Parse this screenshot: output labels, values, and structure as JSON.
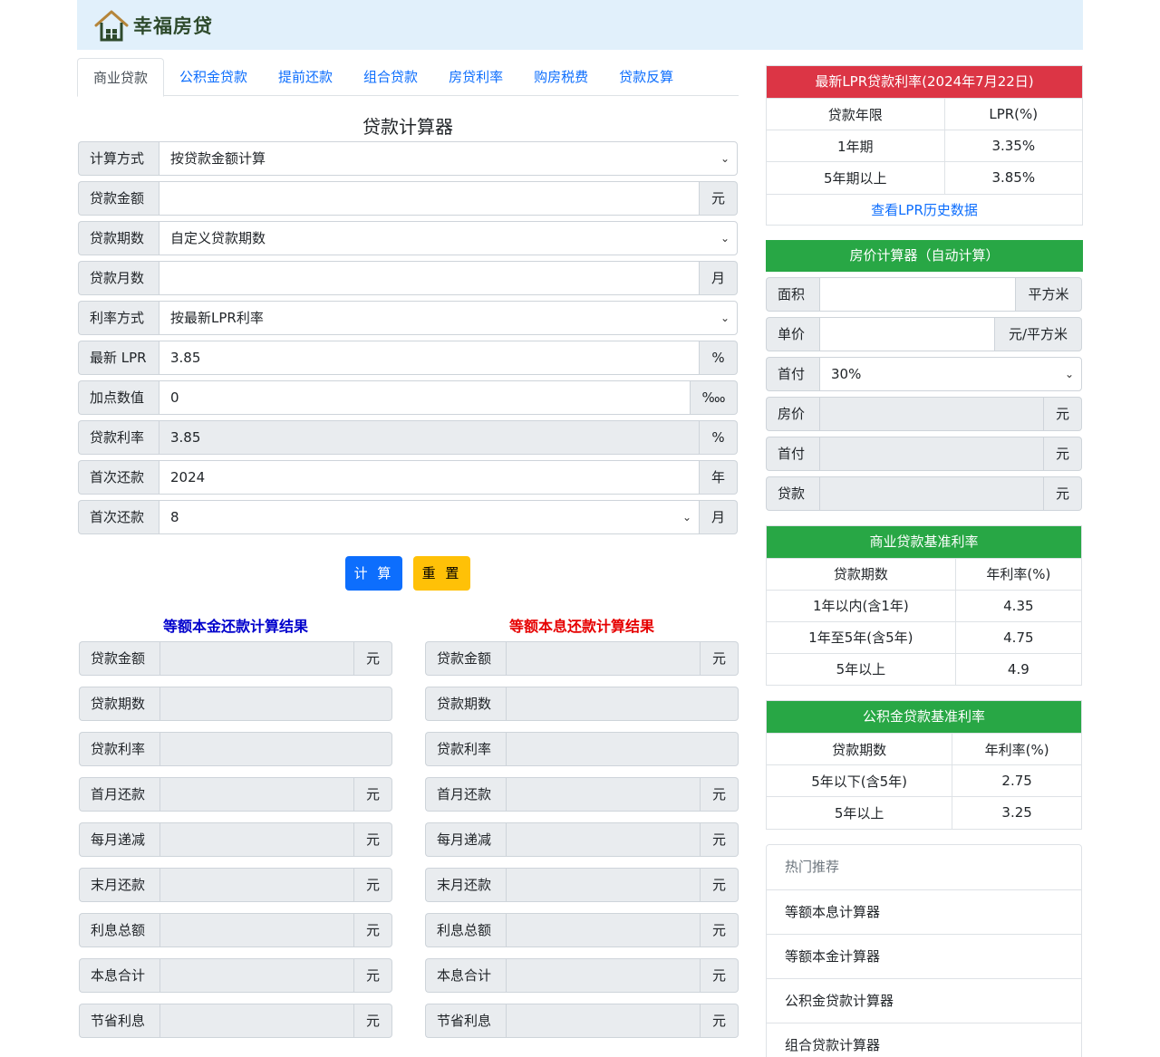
{
  "site": {
    "name": "幸福房贷"
  },
  "tabs": [
    "商业贷款",
    "公积金贷款",
    "提前还款",
    "组合贷款",
    "房贷利率",
    "购房税费",
    "贷款反算"
  ],
  "calc": {
    "title": "贷款计算器",
    "method": {
      "label": "计算方式",
      "value": "按贷款金额计算"
    },
    "amount": {
      "label": "贷款金额",
      "value": "",
      "unit": "元"
    },
    "term": {
      "label": "贷款期数",
      "value": "自定义贷款期数"
    },
    "months": {
      "label": "贷款月数",
      "value": "",
      "unit": "月"
    },
    "rate_mode": {
      "label": "利率方式",
      "value": "按最新LPR利率"
    },
    "lpr": {
      "label": "最新 LPR",
      "value": "3.85",
      "unit": "%"
    },
    "bp": {
      "label": "加点数值",
      "value": "0",
      "unit": "‱"
    },
    "rate": {
      "label": "贷款利率",
      "value": "3.85",
      "unit": "%"
    },
    "first_year": {
      "label": "首次还款",
      "value": "2024",
      "unit": "年"
    },
    "first_month": {
      "label": "首次还款",
      "value": "8",
      "unit": "月"
    },
    "btn_calc": "计 算",
    "btn_reset": "重 置"
  },
  "results": {
    "principal_title": "等额本金还款计算结果",
    "annuity_title": "等额本息还款计算结果",
    "rows": [
      {
        "label": "贷款金额",
        "unit": "元"
      },
      {
        "label": "贷款期数",
        "unit": ""
      },
      {
        "label": "贷款利率",
        "unit": ""
      },
      {
        "label": "首月还款",
        "unit": "元"
      },
      {
        "label": "每月递减",
        "unit": "元"
      },
      {
        "label": "末月还款",
        "unit": "元"
      },
      {
        "label": "利息总额",
        "unit": "元"
      },
      {
        "label": "本息合计",
        "unit": "元"
      },
      {
        "label": "节省利息",
        "unit": "元"
      }
    ]
  },
  "lpr_box": {
    "title": "最新LPR贷款利率(2024年7月22日)",
    "headers": [
      "贷款年限",
      "LPR(%)"
    ],
    "rows": [
      [
        "1年期",
        "3.35%"
      ],
      [
        "5年期以上",
        "3.85%"
      ]
    ],
    "link": "查看LPR历史数据"
  },
  "price_box": {
    "title": "房价计算器（自动计算）",
    "area": {
      "label": "面积",
      "unit": "平方米"
    },
    "unit_price": {
      "label": "单价",
      "unit": "元/平方米"
    },
    "down_ratio": {
      "label": "首付",
      "value": "30%"
    },
    "price": {
      "label": "房价",
      "unit": "元"
    },
    "down": {
      "label": "首付",
      "unit": "元"
    },
    "loan": {
      "label": "贷款",
      "unit": "元"
    }
  },
  "comm_box": {
    "title": "商业贷款基准利率",
    "headers": [
      "贷款期数",
      "年利率(%)"
    ],
    "rows": [
      [
        "1年以内(含1年)",
        "4.35"
      ],
      [
        "1年至5年(含5年)",
        "4.75"
      ],
      [
        "5年以上",
        "4.9"
      ]
    ]
  },
  "fund_box": {
    "title": "公积金贷款基准利率",
    "headers": [
      "贷款期数",
      "年利率(%)"
    ],
    "rows": [
      [
        "5年以下(含5年)",
        "2.75"
      ],
      [
        "5年以上",
        "3.25"
      ]
    ]
  },
  "hot": {
    "title": "热门推荐",
    "items": [
      "等额本息计算器",
      "等额本金计算器",
      "公积金贷款计算器",
      "组合贷款计算器"
    ]
  }
}
